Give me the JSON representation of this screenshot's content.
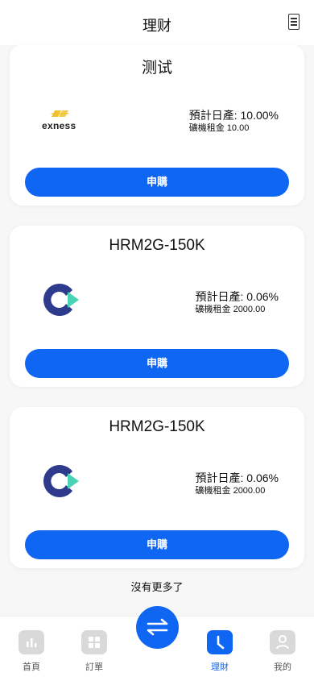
{
  "header": {
    "title": "理财"
  },
  "products": [
    {
      "name": "测试",
      "logo": "exness-logo",
      "logo_text": "exness",
      "yield": "預計日產: 10.00%",
      "rent": "礦機租金 10.00",
      "button": "申購"
    },
    {
      "name": "HRM2G-150K",
      "logo": "c-logo",
      "yield": "預計日產: 0.06%",
      "rent": "礦機租金 2000.00",
      "button": "申購"
    },
    {
      "name": "HRM2G-150K",
      "logo": "c-logo",
      "yield": "預計日產: 0.06%",
      "rent": "礦機租金 2000.00",
      "button": "申購"
    }
  ],
  "footer_note": "沒有更多了",
  "tabbar": {
    "items": [
      {
        "label": "首頁",
        "icon": "bar-chart-icon"
      },
      {
        "label": "訂單",
        "icon": "grid-icon"
      },
      {
        "label": "理財",
        "icon": "clock-icon",
        "active": true
      },
      {
        "label": "我的",
        "icon": "user-icon"
      }
    ],
    "center_icon": "swap-icon"
  },
  "colors": {
    "accent": "#0f66f3",
    "background": "#f7f7f7",
    "card": "#ffffff"
  }
}
